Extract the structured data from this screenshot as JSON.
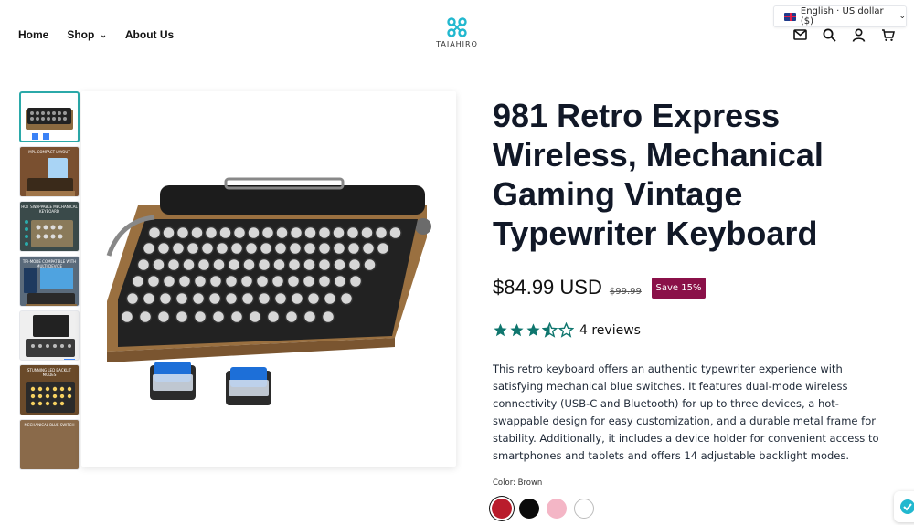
{
  "header": {
    "nav": [
      {
        "label": "Home"
      },
      {
        "label": "Shop"
      },
      {
        "label": "About Us"
      }
    ],
    "logo_text": "TAIAHIRO",
    "language_selector": "English · US dollar ($)",
    "icons": [
      "mail-icon",
      "search-icon",
      "account-icon",
      "cart-icon"
    ]
  },
  "gallery": {
    "thumbnails": [
      {
        "caption": ""
      },
      {
        "caption": "MPL COMPACT LAYOUT"
      },
      {
        "caption": "HOT SWAPPABLE MECHANICAL KEYBOARD"
      },
      {
        "caption": "TRI-MODE COMPATIBLE WITH MULTI-DEVICE"
      },
      {
        "caption": ""
      },
      {
        "caption": "STUNNING LED BACKLIT MODES"
      },
      {
        "caption": "MECHANICAL BLUE SWITCH"
      }
    ]
  },
  "product": {
    "title": "981 Retro Express Wireless, Mechanical Gaming Vintage Typewriter Keyboard",
    "price": "$84.99 USD",
    "compare_price": "$99.99",
    "badge": "Save 15%",
    "rating": 3.5,
    "reviews_text": "4 reviews",
    "description": "This retro keyboard offers an authentic typewriter experience with satisfying mechanical blue switches. It features dual-mode wireless connectivity (USB-C and Bluetooth) for up to three devices, a hot-swappable design for easy customization, and a durable metal frame for stability. Additionally, it includes a device holder for convenient access to smartphones and tablets and offers 14 adjustable backlight modes.",
    "color_label": "Color: Brown",
    "swatches": [
      {
        "name": "red",
        "color": "#b91c2c"
      },
      {
        "name": "black",
        "color": "#0a0a0a"
      },
      {
        "name": "pink",
        "color": "#f4b6c6"
      },
      {
        "name": "white",
        "color": "#ffffff"
      }
    ]
  },
  "colors": {
    "accent": "#2ba9a9",
    "star": "#0f766e",
    "badge": "#8a1048"
  }
}
